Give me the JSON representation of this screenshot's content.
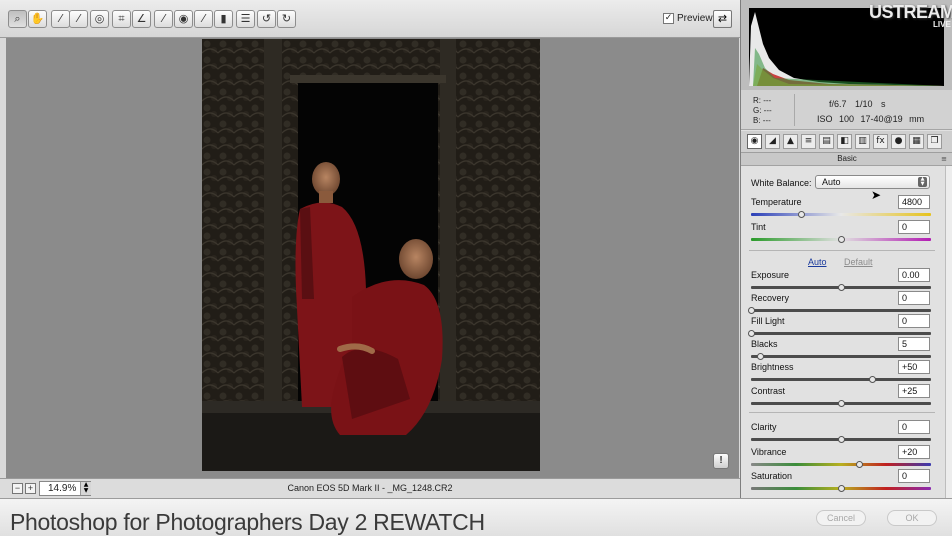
{
  "toolbar": {
    "tools": [
      {
        "name": "zoom-tool",
        "icon": "magnifier-icon",
        "glyph": "⌕"
      },
      {
        "name": "hand-tool",
        "icon": "hand-icon",
        "glyph": "✋"
      },
      {
        "name": "white-balance-tool",
        "icon": "eyedropper-icon",
        "glyph": "⁄"
      },
      {
        "name": "color-sampler-tool",
        "icon": "color-sampler-icon",
        "glyph": "⁄"
      },
      {
        "name": "targeted-adjustment-tool",
        "icon": "target-adjust-icon",
        "glyph": "◎"
      },
      {
        "name": "crop-tool",
        "icon": "crop-icon",
        "glyph": "⌗"
      },
      {
        "name": "straighten-tool",
        "icon": "straighten-icon",
        "glyph": "∠"
      },
      {
        "name": "spot-removal-tool",
        "icon": "brush-icon",
        "glyph": "⁄"
      },
      {
        "name": "red-eye-tool",
        "icon": "red-eye-icon",
        "glyph": "◉"
      },
      {
        "name": "adjustment-brush-tool",
        "icon": "paintbrush-icon",
        "glyph": "⁄"
      },
      {
        "name": "graduated-filter-tool",
        "icon": "gradient-icon",
        "glyph": "▮"
      },
      {
        "name": "preferences-tool",
        "icon": "list-icon",
        "glyph": "☰"
      },
      {
        "name": "rotate-left-tool",
        "icon": "rotate-ccw-icon",
        "glyph": "↺"
      },
      {
        "name": "rotate-right-tool",
        "icon": "rotate-cw-icon",
        "glyph": "↻"
      }
    ],
    "preview_label": "Preview",
    "preview_checked": "✓",
    "fullscreen_glyph": "⇄"
  },
  "status": {
    "zoom_out": "−",
    "zoom_in": "+",
    "zoom_value": "14.9%",
    "zoom_arrows": "▲\n▼",
    "file_info": "Canon EOS 5D Mark II  -  _MG_1248.CR2"
  },
  "canvas": {
    "info_glyph": "!"
  },
  "panel": {
    "ustream": "USTREAM",
    "ustream_live": "LIVE",
    "rgb": {
      "r": "R:  ---",
      "g": "G:  ---",
      "b": "B:  ---"
    },
    "camera": {
      "line1": "f/6.7 1/10 s",
      "line2": "ISO 100 17-40@19 mm"
    },
    "tab_glyphs": [
      "◉",
      "◢",
      "▲",
      "≡",
      "▤",
      "◧",
      "▥",
      "fx",
      "●",
      "▦",
      "❐"
    ],
    "title": "Basic",
    "menu_glyph": "≡",
    "white_balance_label": "White Balance:",
    "white_balance_value": "Auto",
    "auto_link": "Auto",
    "default_link": "Default",
    "sliders": [
      {
        "key": "temperature",
        "label": "Temperature",
        "value": "4800",
        "position": 0.28,
        "track": "temperature"
      },
      {
        "key": "tint",
        "label": "Tint",
        "value": "0",
        "position": 0.5,
        "track": "tint"
      },
      {
        "key": "exposure",
        "label": "Exposure",
        "value": "0.00",
        "position": 0.5,
        "track": "dark"
      },
      {
        "key": "recovery",
        "label": "Recovery",
        "value": "0",
        "position": 0.0,
        "track": "dark"
      },
      {
        "key": "fill-light",
        "label": "Fill Light",
        "value": "0",
        "position": 0.0,
        "track": "dark"
      },
      {
        "key": "blacks",
        "label": "Blacks",
        "value": "5",
        "position": 0.05,
        "track": "dark"
      },
      {
        "key": "brightness",
        "label": "Brightness",
        "value": "+50",
        "position": 0.67,
        "track": "dark"
      },
      {
        "key": "contrast",
        "label": "Contrast",
        "value": "+25",
        "position": 0.5,
        "track": "dark"
      },
      {
        "key": "clarity",
        "label": "Clarity",
        "value": "0",
        "position": 0.5,
        "track": "dark"
      },
      {
        "key": "vibrance",
        "label": "Vibrance",
        "value": "+20",
        "position": 0.6,
        "track": "vibrance"
      },
      {
        "key": "saturation",
        "label": "Saturation",
        "value": "0",
        "position": 0.5,
        "track": "saturation"
      }
    ]
  },
  "caption": "Photoshop for Photographers Day 2 REWATCH",
  "buttons": {
    "cancel": "Cancel",
    "ok": "OK"
  },
  "colors": {
    "canvas_bg": "#8b8b8b",
    "robe_red": "#7d1418",
    "link_blue": "#1a3a9c"
  }
}
